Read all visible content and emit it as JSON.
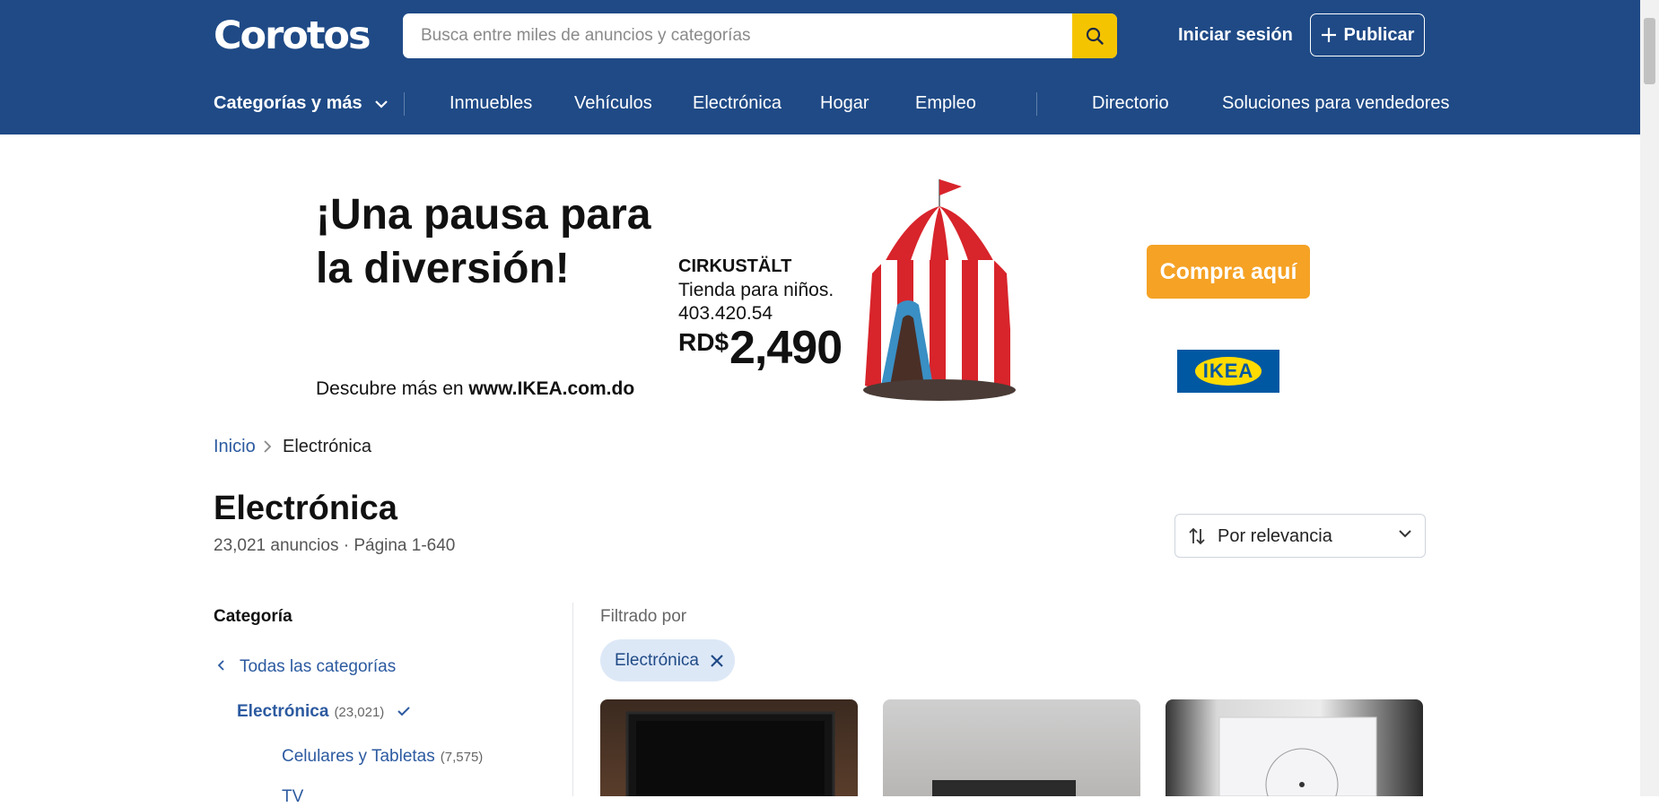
{
  "header": {
    "logo": "Corotos",
    "search": {
      "placeholder": "Busca entre miles de anuncios y categorías",
      "value": ""
    },
    "login_label": "Iniciar sesión",
    "publish_label": "Publicar",
    "nav": {
      "categories": "Categorías y más",
      "items": [
        "Inmuebles",
        "Vehículos",
        "Electrónica",
        "Hogar",
        "Empleo"
      ],
      "directory": "Directorio",
      "sellers": "Soluciones para vendedores"
    },
    "colors": {
      "background": "#1f4a86",
      "search_button": "#f5c400"
    }
  },
  "banner": {
    "headline_line1": "¡Una pausa para",
    "headline_line2": "la diversión!",
    "footer_prefix": "Descubre más en ",
    "footer_link": "www.IKEA.com.do",
    "product_name": "CIRKUSTÄLT",
    "product_desc": "Tienda para niños.",
    "product_code": "403.420.54",
    "currency": "RD$",
    "price": "2,490",
    "cta": "Compra aquí",
    "brand": "IKEA"
  },
  "breadcrumb": {
    "home": "Inicio",
    "current": "Electrónica"
  },
  "page": {
    "title": "Electrónica",
    "meta": "23,021 anuncios · Página 1-640",
    "sort_label": "Por relevancia"
  },
  "sidebar": {
    "title": "Categoría",
    "all_label": "Todas las categorías",
    "current": {
      "label": "Electrónica",
      "count": "(23,021)"
    },
    "subcategories": [
      {
        "label": "Celulares y Tabletas",
        "count": "(7,575)"
      },
      {
        "label": "TV",
        "count": ""
      }
    ]
  },
  "results": {
    "filtered_by": "Filtrado por",
    "active_filter": "Electrónica"
  }
}
